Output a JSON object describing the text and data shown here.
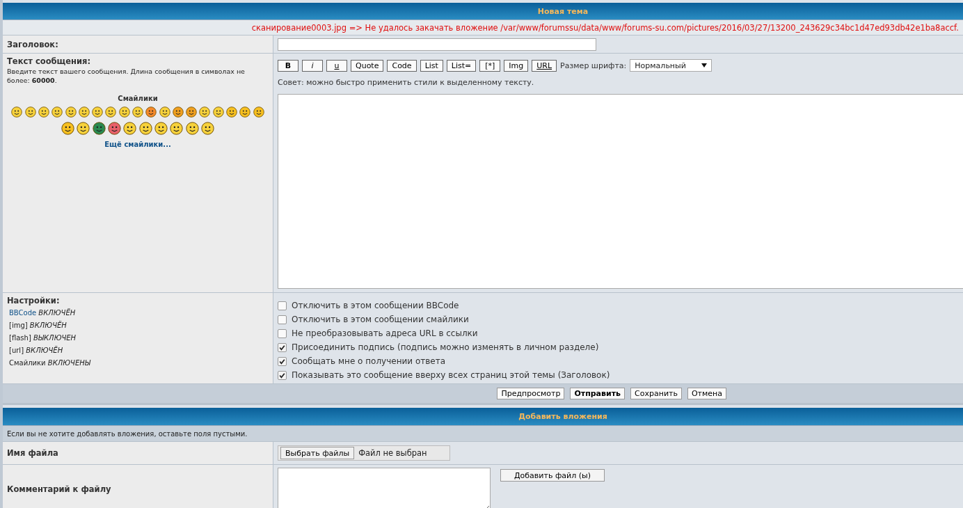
{
  "header": {
    "title": "Новая тема"
  },
  "error": "сканирование0003.jpg => Не удалось закачать вложение /var/www/forumssu/data/www/forums-su.com/pictures/2016/03/27/13200_243629c34bc1d47ed93db42e1ba8accf.",
  "subject": {
    "label": "Заголовок:"
  },
  "message": {
    "label": "Текст сообщения:",
    "hint": "Введите текст вашего сообщения. Длина сообщения в символах не более: **60000**.",
    "smilies_title": "Смайлики",
    "more_smilies": "Ещё смайлики...",
    "toolbar": [
      {
        "label": "B",
        "kind": "bold"
      },
      {
        "label": "i",
        "kind": "italic"
      },
      {
        "label": "u",
        "kind": "underline"
      },
      {
        "label": "Quote",
        "kind": "plain"
      },
      {
        "label": "Code",
        "kind": "plain"
      },
      {
        "label": "List",
        "kind": "plain"
      },
      {
        "label": "List=",
        "kind": "plain"
      },
      {
        "label": "[*]",
        "kind": "plain"
      },
      {
        "label": "Img",
        "kind": "plain"
      },
      {
        "label": "URL",
        "kind": "underline"
      }
    ],
    "font_size": {
      "label": "Размер шрифта:",
      "value": "Нормальный"
    },
    "tip": "Совет: можно быстро применить стили к выделенному тексту."
  },
  "settings": {
    "label": "Настройки:",
    "items": [
      {
        "name": "BBCode",
        "status": "ВКЛЮЧЁН",
        "kind": "link"
      },
      {
        "name": "[img]",
        "status": "ВКЛЮЧЁН",
        "kind": "text"
      },
      {
        "name": "[flash]",
        "status": "ВЫКЛЮЧЕН",
        "kind": "text"
      },
      {
        "name": "[url]",
        "status": "ВКЛЮЧЁН",
        "kind": "text"
      },
      {
        "name": "Смайлики",
        "status": "ВКЛЮЧЕНЫ",
        "kind": "text"
      }
    ],
    "options": [
      {
        "label": "Отключить в этом сообщении BBCode",
        "checked": false
      },
      {
        "label": "Отключить в этом сообщении смайлики",
        "checked": false
      },
      {
        "label": "Не преобразовывать адреса URL в ссылки",
        "checked": false
      },
      {
        "label": "Присоединить подпись (подпись можно изменять в личном разделе)",
        "checked": true
      },
      {
        "label": "Сообщать мне о получении ответа",
        "checked": true
      },
      {
        "label": "Показывать это сообщение вверху всех страниц этой темы (Заголовок)",
        "checked": true
      }
    ]
  },
  "actions": [
    {
      "label": "Предпросмотр",
      "kind": "plain"
    },
    {
      "label": "Отправить",
      "kind": "bold"
    },
    {
      "label": "Сохранить",
      "kind": "plain"
    },
    {
      "label": "Отмена",
      "kind": "plain"
    }
  ],
  "attachments": {
    "title": "Добавить вложения",
    "note": "Если вы не хотите добавлять вложения, оставьте поля пустыми.",
    "file_label": "Имя файла",
    "choose_button": "Выбрать файлы",
    "no_file": "Файл не выбран",
    "comment_label": "Комментарий к файлу",
    "add_button": "Добавить файл (ы)"
  }
}
